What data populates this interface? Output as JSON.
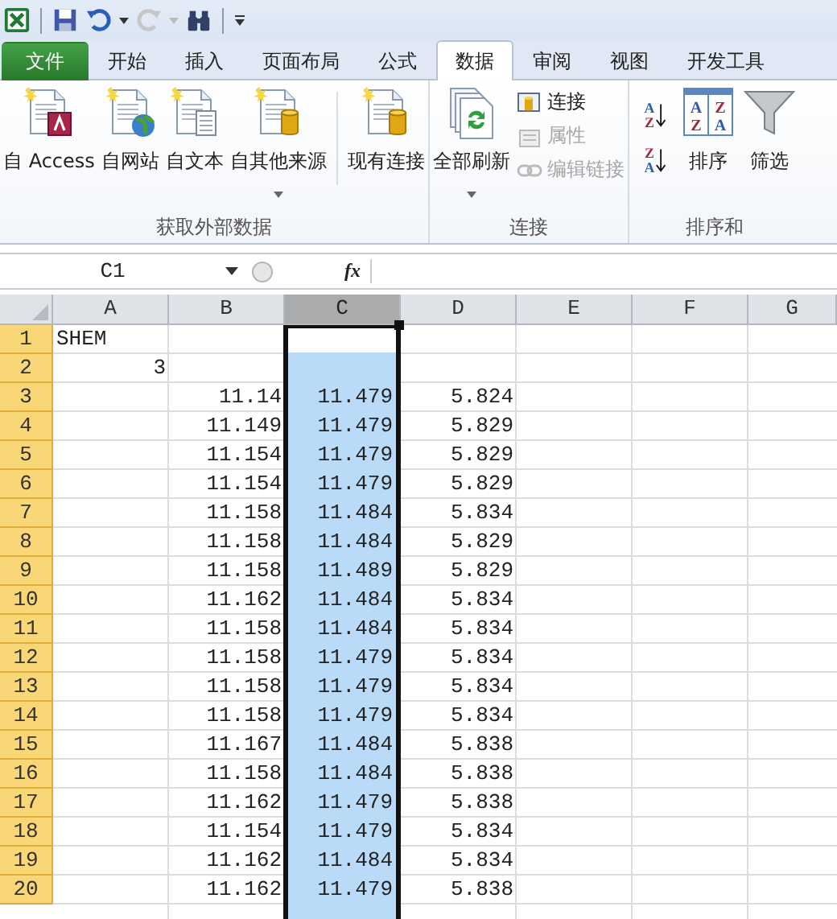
{
  "tabs": [
    {
      "label": "文件",
      "kind": "file",
      "selected": false
    },
    {
      "label": "开始",
      "kind": "normal",
      "selected": false
    },
    {
      "label": "插入",
      "kind": "normal",
      "selected": false
    },
    {
      "label": "页面布局",
      "kind": "normal",
      "selected": false
    },
    {
      "label": "公式",
      "kind": "normal",
      "selected": false
    },
    {
      "label": "数据",
      "kind": "normal",
      "selected": true
    },
    {
      "label": "审阅",
      "kind": "normal",
      "selected": false
    },
    {
      "label": "视图",
      "kind": "normal",
      "selected": false
    },
    {
      "label": "开发工具",
      "kind": "normal",
      "selected": false
    }
  ],
  "ribbon_groups": [
    {
      "label": "获取外部数据",
      "items": [
        {
          "kind": "access",
          "label": "自 Access",
          "dropdown": false
        },
        {
          "kind": "web",
          "label": "自网站",
          "dropdown": false
        },
        {
          "kind": "text",
          "label": "自文本",
          "dropdown": false
        },
        {
          "kind": "database",
          "label": "自其他来源",
          "dropdown": true
        },
        {
          "kind": "separator"
        },
        {
          "kind": "database",
          "label": "现有连接",
          "dropdown": false
        }
      ]
    },
    {
      "label": "连接",
      "items": [
        {
          "kind": "refresh",
          "label": "全部刷新",
          "dropdown": true
        },
        {
          "kind": "stack",
          "items": [
            {
              "kind": "connection",
              "label": "连接",
              "disabled": false
            },
            {
              "kind": "properties",
              "label": "属性",
              "disabled": true
            },
            {
              "kind": "link",
              "label": "编辑链接",
              "disabled": true
            }
          ]
        }
      ]
    },
    {
      "label": "排序和",
      "items": [
        {
          "kind": "sortpair",
          "buttons": [
            {
              "top": "A",
              "bottom": "Z"
            },
            {
              "top": "Z",
              "bottom": "A"
            }
          ]
        },
        {
          "kind": "sort",
          "label": "排序",
          "dropdown": false,
          "icon_letters": [
            "A",
            "Z",
            "Z",
            "A"
          ]
        },
        {
          "kind": "filter",
          "label": "筛选",
          "dropdown": false
        }
      ]
    }
  ],
  "formula_bar": {
    "name_box": "C1",
    "function_label": "fx"
  },
  "columns": [
    {
      "label": "A",
      "selected": false
    },
    {
      "label": "B",
      "selected": false
    },
    {
      "label": "C",
      "selected": true
    },
    {
      "label": "D",
      "selected": false
    },
    {
      "label": "E",
      "selected": false
    },
    {
      "label": "F",
      "selected": false
    },
    {
      "label": "G",
      "selected": false
    }
  ],
  "rows": [
    {
      "number": "1",
      "selected": true,
      "active": true,
      "a": "SHEM"
    },
    {
      "number": "2",
      "selected": true,
      "active": false,
      "a": "3"
    },
    {
      "number": "3",
      "selected": true,
      "active": false,
      "b": "11.14",
      "c": "11.479",
      "d": "5.824"
    },
    {
      "number": "4",
      "selected": true,
      "active": false,
      "b": "11.149",
      "c": "11.479",
      "d": "5.829"
    },
    {
      "number": "5",
      "selected": true,
      "active": false,
      "b": "11.154",
      "c": "11.479",
      "d": "5.829"
    },
    {
      "number": "6",
      "selected": true,
      "active": false,
      "b": "11.154",
      "c": "11.479",
      "d": "5.829"
    },
    {
      "number": "7",
      "selected": true,
      "active": false,
      "b": "11.158",
      "c": "11.484",
      "d": "5.834"
    },
    {
      "number": "8",
      "selected": true,
      "active": false,
      "b": "11.158",
      "c": "11.484",
      "d": "5.829"
    },
    {
      "number": "9",
      "selected": true,
      "active": false,
      "b": "11.158",
      "c": "11.489",
      "d": "5.829"
    },
    {
      "number": "10",
      "selected": true,
      "active": false,
      "b": "11.162",
      "c": "11.484",
      "d": "5.834"
    },
    {
      "number": "11",
      "selected": true,
      "active": false,
      "b": "11.158",
      "c": "11.484",
      "d": "5.834"
    },
    {
      "number": "12",
      "selected": true,
      "active": false,
      "b": "11.158",
      "c": "11.479",
      "d": "5.834"
    },
    {
      "number": "13",
      "selected": true,
      "active": false,
      "b": "11.158",
      "c": "11.479",
      "d": "5.834"
    },
    {
      "number": "14",
      "selected": true,
      "active": false,
      "b": "11.158",
      "c": "11.479",
      "d": "5.834"
    },
    {
      "number": "15",
      "selected": true,
      "active": false,
      "b": "11.167",
      "c": "11.484",
      "d": "5.838"
    },
    {
      "number": "16",
      "selected": true,
      "active": false,
      "b": "11.158",
      "c": "11.484",
      "d": "5.838"
    },
    {
      "number": "17",
      "selected": true,
      "active": false,
      "b": "11.162",
      "c": "11.479",
      "d": "5.838"
    },
    {
      "number": "18",
      "selected": true,
      "active": false,
      "b": "11.154",
      "c": "11.479",
      "d": "5.834"
    },
    {
      "number": "19",
      "selected": true,
      "active": false,
      "b": "11.162",
      "c": "11.484",
      "d": "5.834"
    },
    {
      "number": "20",
      "selected": true,
      "active": false,
      "b": "11.162",
      "c": "11.479",
      "d": "5.838"
    }
  ]
}
